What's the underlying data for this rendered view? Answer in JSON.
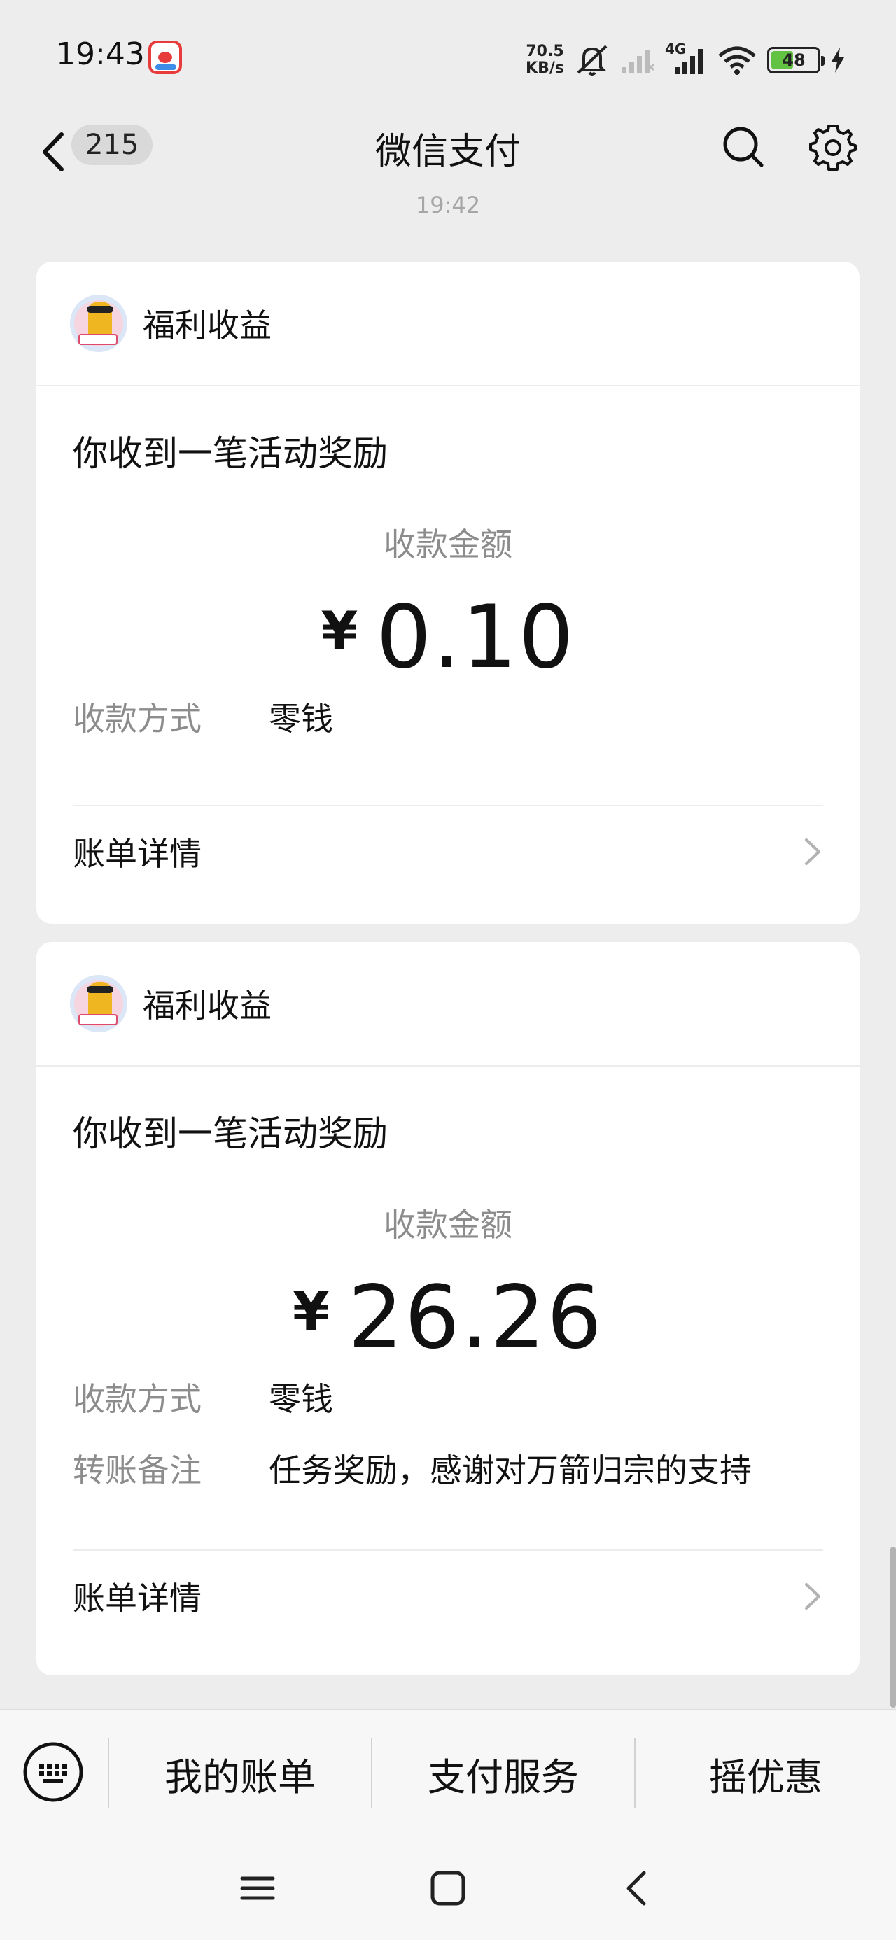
{
  "status_bar": {
    "time": "19:43",
    "net_speed_value": "70.5",
    "net_speed_unit": "KB/s",
    "battery_level": "48",
    "battery_fill_fraction": 0.48,
    "network_type": "4G"
  },
  "nav": {
    "badge_count": "215",
    "title": "微信支付"
  },
  "timestamp": "19:42",
  "cards": [
    {
      "source": "福利收益",
      "notice": "你收到一笔活动奖励",
      "amount_label": "收款金额",
      "currency": "¥",
      "amount": "0.10",
      "rows": [
        {
          "key": "收款方式",
          "value": "零钱"
        }
      ],
      "detail_label": "账单详情"
    },
    {
      "source": "福利收益",
      "notice": "你收到一笔活动奖励",
      "amount_label": "收款金额",
      "currency": "¥",
      "amount": "26.26",
      "rows": [
        {
          "key": "收款方式",
          "value": "零钱"
        },
        {
          "key": "转账备注",
          "value": "任务奖励，感谢对万箭归宗的支持"
        }
      ],
      "detail_label": "账单详情"
    }
  ],
  "menu": {
    "items": [
      "我的账单",
      "支付服务",
      "摇优惠"
    ]
  },
  "colors": {
    "background": "#ededed",
    "card": "#ffffff",
    "secondary_text": "#8c8c8c",
    "battery": "#62c241"
  }
}
